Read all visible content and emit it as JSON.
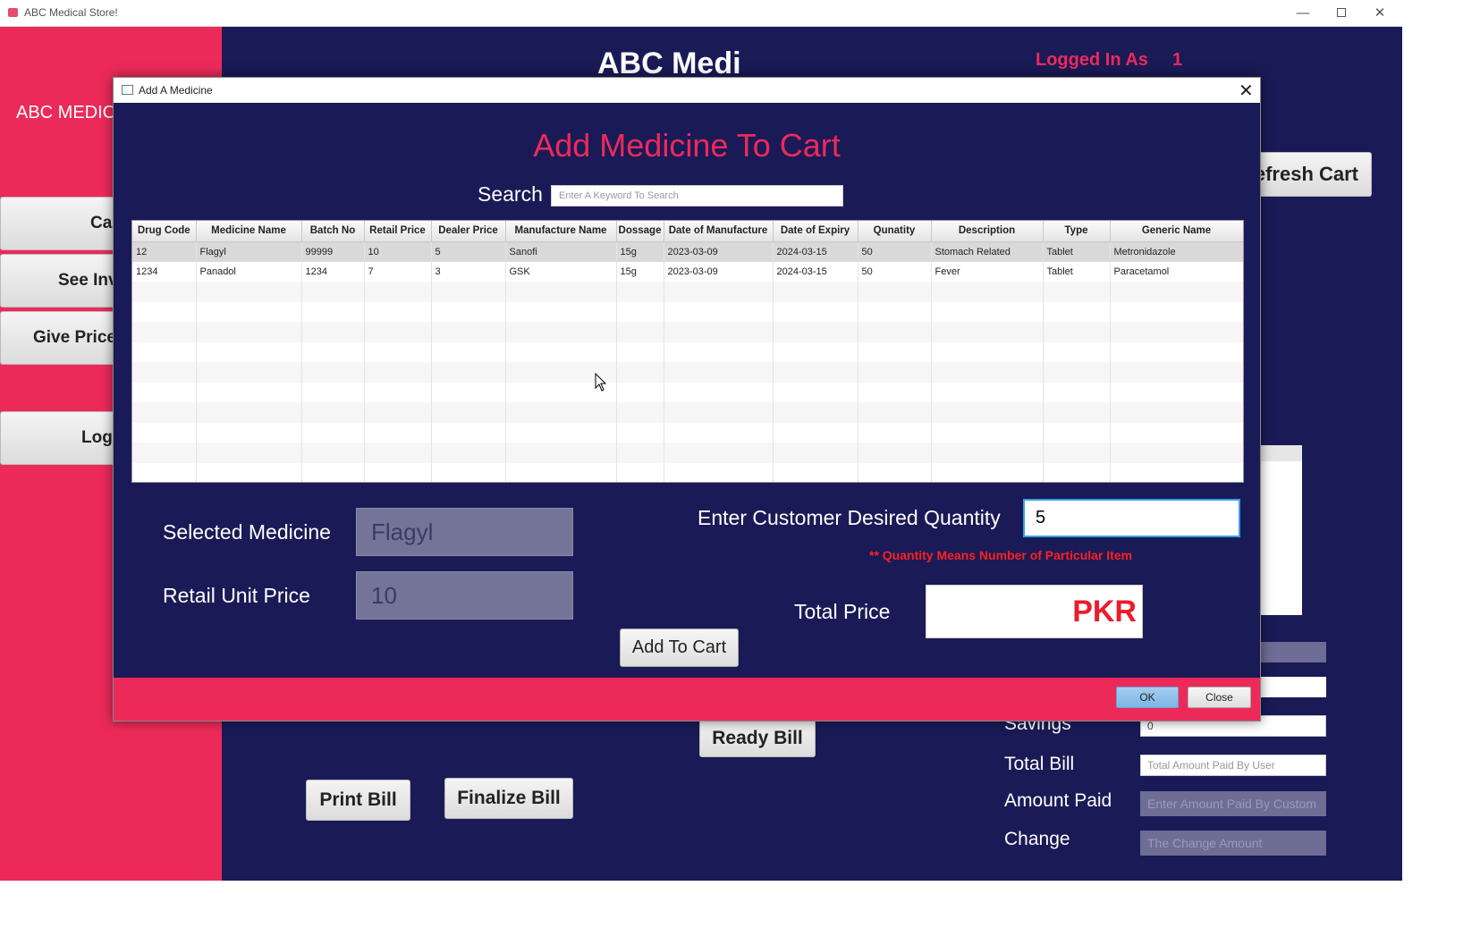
{
  "window": {
    "title": "ABC Medical Store!"
  },
  "sidebar": {
    "brand": "ABC MEDIC",
    "buttons": [
      "Ca",
      "See Inv",
      "Give Price (",
      "Log"
    ]
  },
  "main": {
    "heading": "ABC Medi",
    "logged_in_label": "Logged In As",
    "logged_in_id": "1",
    "refresh_label": "efresh Cart",
    "ready_bill": "Ready Bill",
    "print_bill": "Print Bill",
    "finalize_bill": "Finalize Bill",
    "summary": {
      "savings_label": "Savings",
      "savings_value": "0",
      "total_bill_label": "Total Bill",
      "total_bill_placeholder": "Total Amount Paid By User",
      "amount_paid_label": "Amount Paid",
      "amount_paid_placeholder": "Enter Amount Paid By Custom",
      "change_label": "Change",
      "change_placeholder": "The Change Amount"
    }
  },
  "dialog": {
    "title": "Add A Medicine",
    "heading": "Add Medicine To Cart",
    "search_label": "Search",
    "search_placeholder": "Enter A Keyword To Search",
    "columns": [
      "Drug Code",
      "Medicine Name",
      "Batch No",
      "Retail Price",
      "Dealer Price",
      "Manufacture Name",
      "Dossage",
      "Date of Manufacture",
      "Date of Expiry",
      "Qunatity",
      "Description",
      "Type",
      "Generic Name"
    ],
    "rows": [
      [
        "12",
        "Flagyl",
        "99999",
        "10",
        "5",
        "Sanofi",
        "15g",
        "2023-03-09",
        "2024-03-15",
        "50",
        "Stomach Related",
        "Tablet",
        "Metronidazole"
      ],
      [
        "1234",
        "Panadol",
        "1234",
        "7",
        "3",
        "GSK",
        "15g",
        "2023-03-09",
        "2024-03-15",
        "50",
        "Fever",
        "Tablet",
        "Paracetamol"
      ]
    ],
    "selected_medicine_label": "Selected Medicine",
    "selected_medicine_value": "Flagyl",
    "retail_unit_price_label": "Retail Unit Price",
    "retail_unit_price_value": "10",
    "quantity_label": "Enter Customer Desired Quantity",
    "quantity_value": "5",
    "quantity_note": "** Quantity Means Number of Particular Item",
    "total_price_label": "Total Price",
    "currency": "PKR",
    "add_to_cart": "Add To Cart",
    "ok": "OK",
    "close": "Close"
  },
  "colors": {
    "navy": "#1a1a57",
    "pink": "#ec2a5a",
    "ok_blue": "#7db6e6"
  }
}
